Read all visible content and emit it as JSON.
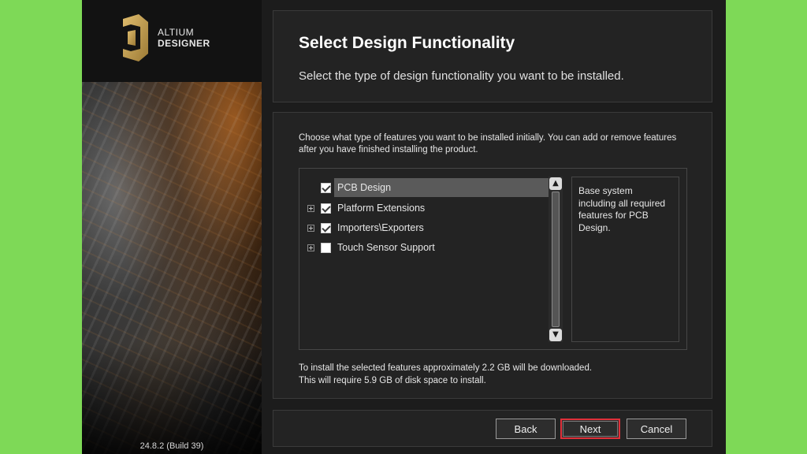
{
  "branding": {
    "logo_line1": "ALTIUM",
    "logo_line2": "DESIGNER",
    "version": "24.8.2 (Build 39)",
    "accent_color": "#c8a255"
  },
  "header": {
    "title": "Select Design Functionality",
    "subtitle": "Select the type of design functionality you want to be installed."
  },
  "content": {
    "intro": "Choose what type of features you want to be installed initially. You can add or remove features after you have finished installing the product.",
    "features": [
      {
        "label": "PCB Design",
        "checked": true,
        "expandable": false,
        "selected": true
      },
      {
        "label": "Platform Extensions",
        "checked": true,
        "expandable": true,
        "selected": false
      },
      {
        "label": "Importers\\Exporters",
        "checked": true,
        "expandable": true,
        "selected": false
      },
      {
        "label": "Touch Sensor Support",
        "checked": false,
        "expandable": true,
        "selected": false
      }
    ],
    "description": "Base system including all required features for PCB Design.",
    "size_note_line1": "To install the selected features approximately 2.2 GB will be downloaded.",
    "size_note_line2": "This will require 5.9 GB of disk space to install."
  },
  "footer": {
    "back_label": "Back",
    "next_label": "Next",
    "cancel_label": "Cancel",
    "highlight_color": "#e0303a"
  },
  "icons": {
    "scroll_up": "▲",
    "scroll_down": "▼"
  }
}
